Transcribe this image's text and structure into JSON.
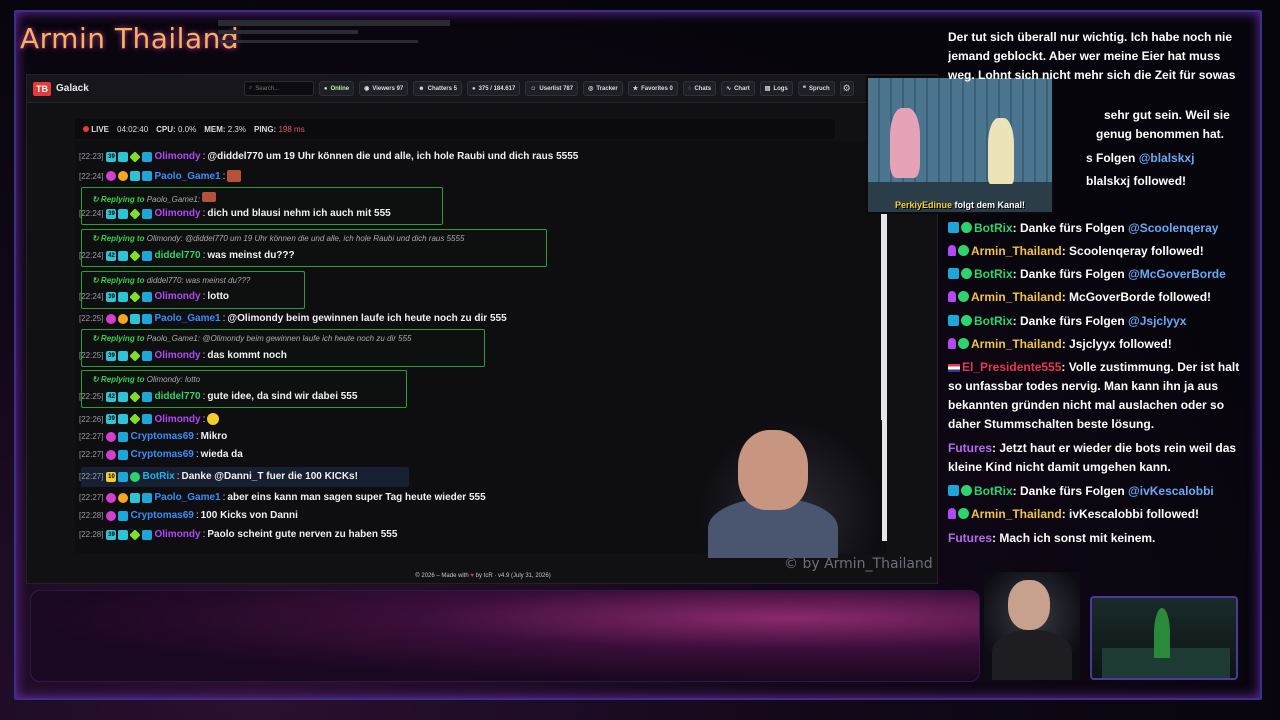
{
  "overlay": {
    "title": "Armin Thailand",
    "watermark": "© by Armin_Thailand"
  },
  "app": {
    "logo": "TB",
    "name": "Galack",
    "search_placeholder": "Search...",
    "toolbar": [
      {
        "label": "Online",
        "icon": "wifi-icon"
      },
      {
        "label": "Viewers 97",
        "icon": "eye-icon"
      },
      {
        "label": "Chatters 5",
        "icon": "users-icon"
      },
      {
        "label": "375 / 184.617",
        "icon": "chat-bubble-icon"
      },
      {
        "label": "Userlist 787",
        "icon": "user-icon"
      },
      {
        "label": "Tracker",
        "icon": "tracker-icon"
      },
      {
        "label": "Favorites 0",
        "icon": "star-icon"
      },
      {
        "label": "Chats",
        "icon": "chats-icon"
      },
      {
        "label": "Chart",
        "icon": "chart-icon"
      },
      {
        "label": "Logs",
        "icon": "logs-icon"
      },
      {
        "label": "Spruch",
        "icon": "quote-icon"
      }
    ],
    "status": {
      "live": "LIVE",
      "live_time": "04:02:40",
      "cpu_label": "CPU:",
      "cpu": "0.0%",
      "mem_label": "MEM:",
      "mem": "2.3%",
      "ping_label": "PING:",
      "ping": "198 ms"
    },
    "footer": {
      "pre": "© 2026 – Made with",
      "heart": "♥",
      "post": "by tcR · v4.9 (July 31, 2026)"
    }
  },
  "chat": [
    {
      "ts": "[22:23]",
      "user": "Olimondy",
      "text": "@diddel770 um 19 Uhr können die und alle, ich hole Raubi und dich raus 5555"
    },
    {
      "ts": "[22:24]",
      "user": "Paolo_Game1",
      "text": ""
    },
    {
      "reply_to": "Paolo_Game1:",
      "ts": "[22:24]",
      "user": "Olimondy",
      "text": "dich und blausi nehm ich auch mit 555"
    },
    {
      "reply_to": "Olimondy:",
      "reply_text": "@diddel770 um 19 Uhr können die und alle, ich hole Raubi und dich raus 5555",
      "ts": "[22:24]",
      "user": "diddel770",
      "text": "was meinst du???"
    },
    {
      "reply_to": "diddel770:",
      "reply_text": "was meinst du???",
      "ts": "[22:24]",
      "user": "Olimondy",
      "text": "lotto"
    },
    {
      "ts": "[22:25]",
      "user": "Paolo_Game1",
      "text": "@Olimondy beim gewinnen laufe ich heute noch zu dir 555"
    },
    {
      "reply_to": "Paolo_Game1:",
      "reply_text": "@Olimondy beim gewinnen laufe ich heute noch zu dir 555",
      "ts": "[22:25]",
      "user": "Olimondy",
      "text": "das kommt noch"
    },
    {
      "reply_to": "Olimondy:",
      "reply_text": "lotto",
      "ts": "[22:25]",
      "user": "diddel770",
      "text": "gute idee, da sind wir dabei 555"
    },
    {
      "ts": "[22:26]",
      "user": "Olimondy",
      "text": ""
    },
    {
      "ts": "[22:27]",
      "user": "Cryptomas69",
      "text": "Mikro"
    },
    {
      "ts": "[22:27]",
      "user": "Cryptomas69",
      "text": "wieda da"
    },
    {
      "ts": "[22:27]",
      "user": "BotRix",
      "badge": "10",
      "text": "Danke @Danni_T fuer die 100 KICKs!"
    },
    {
      "ts": "[22:27]",
      "user": "Paolo_Game1",
      "text": "aber eins kann man sagen super Tag heute wieder 555"
    },
    {
      "ts": "[22:28]",
      "user": "Cryptomas69",
      "text": "100 Kicks von Danni"
    },
    {
      "ts": "[22:28]",
      "user": "Olimondy",
      "text": "Paolo scheint gute nerven zu haben 555"
    }
  ],
  "alert": {
    "name": "PerkiyEdinue",
    "text": "folgt dem Kanal!"
  },
  "side_chat": {
    "top_text": "Der tut sich überall nur wichtig. Ich habe noch nie jemand geblockt. Aber wer meine Eier hat muss weg. Lohnt sich nicht mehr sich die Zeit für sowas",
    "partial_1": "sehr gut sein. Weil sie",
    "partial_2": "genug benommen hat.",
    "partial_3": "s Folgen",
    "partial_3_mention": "@blalskxj",
    "partial_4": "blalskxj followed!",
    "lines": [
      {
        "name": "BotRix",
        "msg": ": Danke fürs Folgen ",
        "mention": "@Scoolenqeray"
      },
      {
        "name": "Armin_Thailand",
        "msg": ": Scoolenqeray followed!"
      },
      {
        "name": "BotRix",
        "msg": ": Danke fürs Folgen ",
        "mention": "@McGoverBorde"
      },
      {
        "name": "Armin_Thailand",
        "msg": ": McGoverBorde followed!"
      },
      {
        "name": "BotRix",
        "msg": ": Danke fürs Folgen ",
        "mention": "@Jsjclyyx"
      },
      {
        "name": "Armin_Thailand",
        "msg": ": Jsjclyyx followed!"
      },
      {
        "name": "El_Presidente555",
        "msg": ": Volle zustimmung. Der ist halt so unfassbar todes nervig. Man kann ihn ja aus bekannten gründen nicht mal auslachen oder so daher Stummschalten beste lösung."
      },
      {
        "name": "Futures",
        "msg": ": Jetzt haut er wieder die bots rein weil das kleine Kind nicht damit umgehen kann."
      },
      {
        "name": "BotRix",
        "msg": ": Danke fürs Folgen ",
        "mention": "@ivKescalobbi"
      },
      {
        "name": "Armin_Thailand",
        "msg": ": ivKescalobbi followed!"
      },
      {
        "name": "Futures",
        "msg": ": Mach ich sonst mit keinem."
      }
    ]
  }
}
